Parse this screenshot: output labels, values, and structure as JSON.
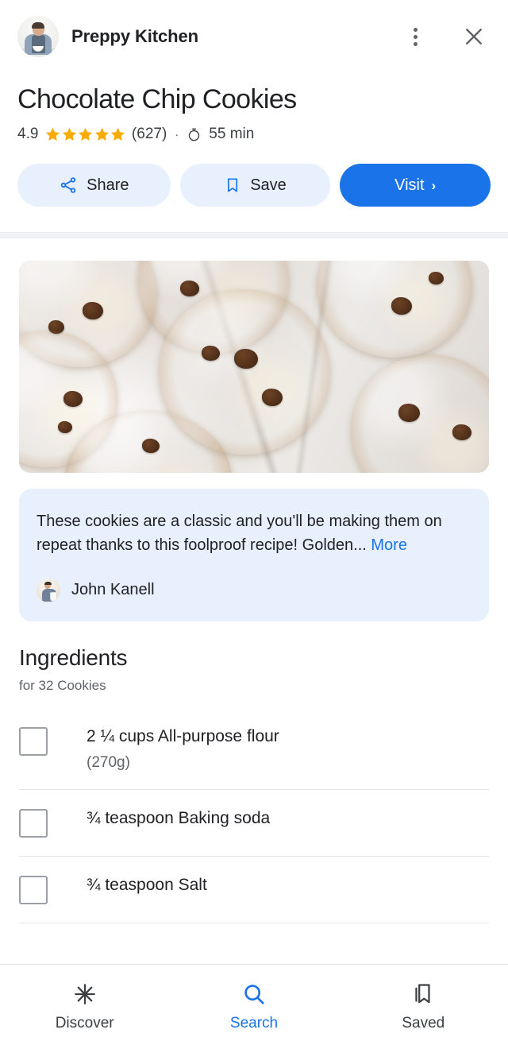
{
  "header": {
    "publisher_name": "Preppy Kitchen",
    "avatar": "publisher-avatar",
    "menu_icon": "kebab-menu-icon",
    "close_icon": "close-icon"
  },
  "recipe": {
    "title": "Chocolate Chip Cookies",
    "rating_value": "4.9",
    "stars_filled": 5,
    "rating_count": "(627)",
    "separator": "·",
    "timer_icon": "timer-icon",
    "time": "55 min"
  },
  "actions": {
    "share_label": "Share",
    "share_icon": "share-icon",
    "save_label": "Save",
    "save_icon": "bookmark-icon",
    "visit_label": "Visit",
    "visit_chevron": "›"
  },
  "hero": {
    "alt": "chocolate chip cookies on marble"
  },
  "description": {
    "text": "These cookies are a classic and you'll be making them on repeat thanks to this foolproof recipe! Golden...",
    "more_label": "More",
    "author_name": "John Kanell",
    "author_avatar": "author-avatar"
  },
  "ingredients": {
    "title": "Ingredients",
    "subtitle": "for 32 Cookies",
    "items": [
      {
        "main": "2 ¼ cups All-purpose flour",
        "sub": "(270g)"
      },
      {
        "main": "¾ teaspoon Baking soda",
        "sub": ""
      },
      {
        "main": "¾ teaspoon Salt",
        "sub": ""
      }
    ]
  },
  "bottom_nav": {
    "items": [
      {
        "label": "Discover",
        "icon": "discover-asterisk-icon",
        "active": false
      },
      {
        "label": "Search",
        "icon": "search-icon",
        "active": true
      },
      {
        "label": "Saved",
        "icon": "bookmarks-icon",
        "active": false
      }
    ]
  },
  "colors": {
    "accent": "#1a73e8",
    "tonal": "#e8f0fe",
    "star": "#f9ab00",
    "text_primary": "#202124",
    "text_secondary": "#5f6368"
  }
}
